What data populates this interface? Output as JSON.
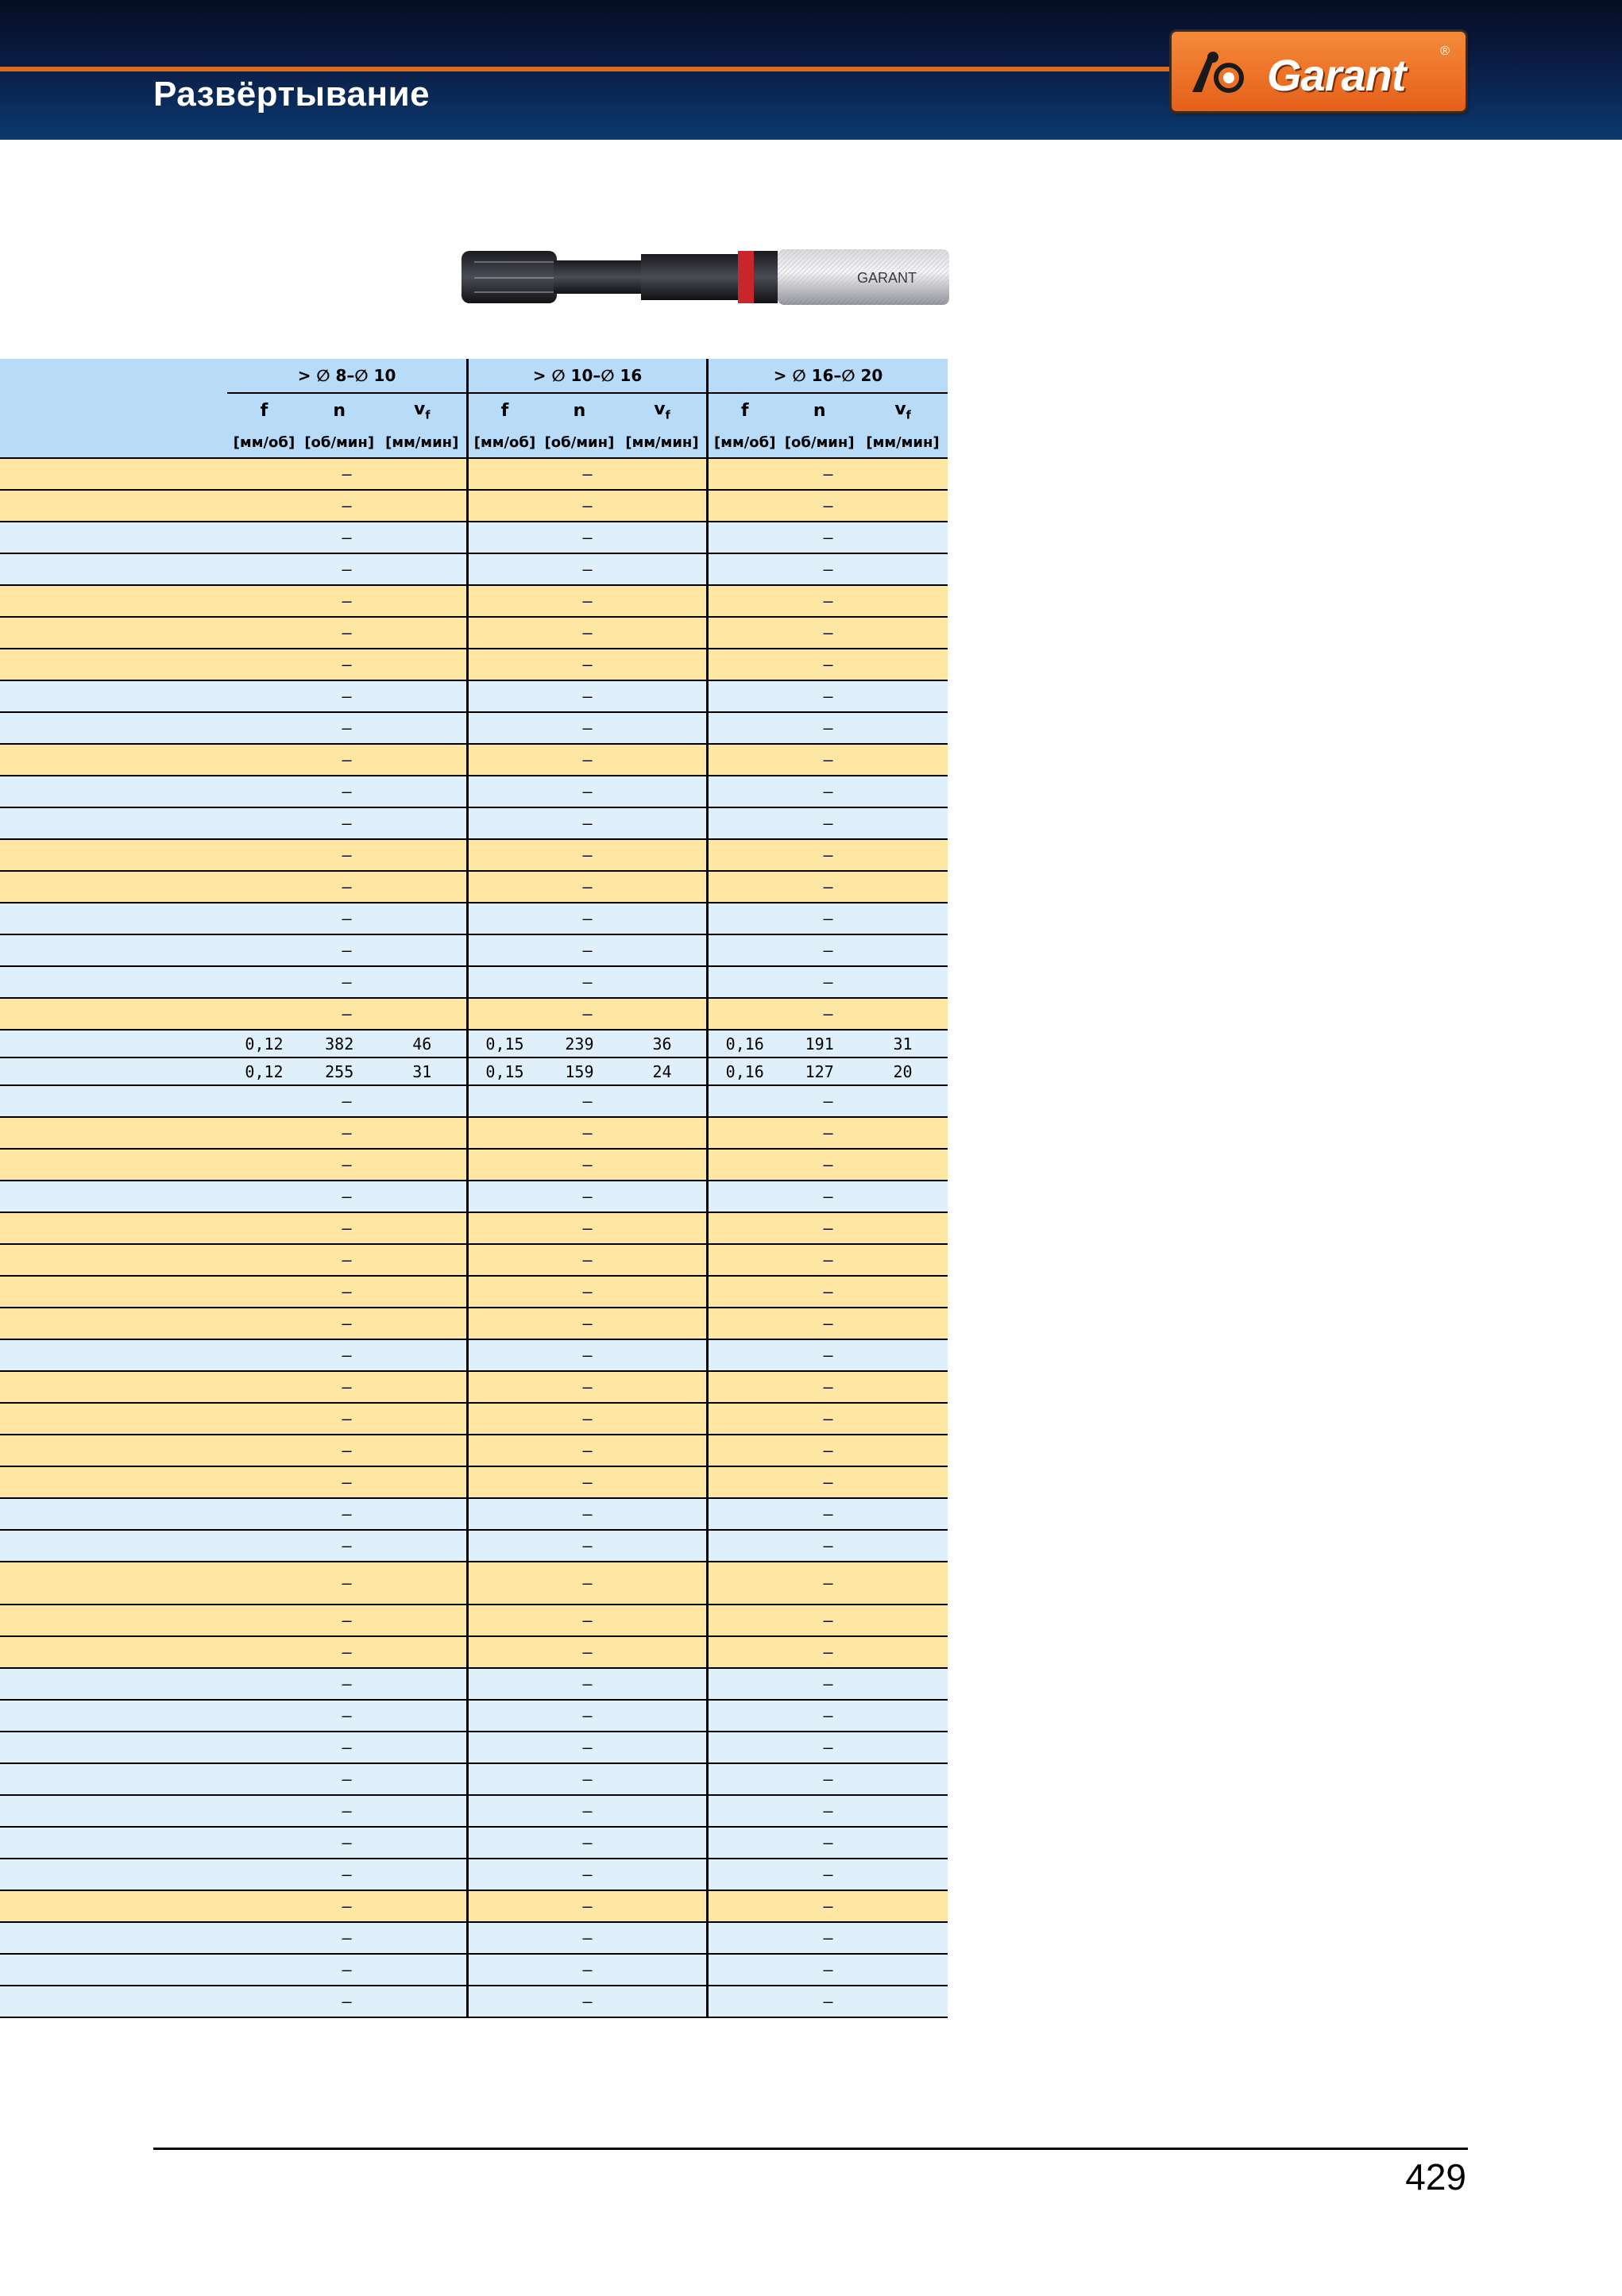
{
  "header": {
    "title": "Развёртывание",
    "logo_text": "Garant",
    "logo_reg": "®"
  },
  "tool": {
    "label": "GARANT"
  },
  "table": {
    "groups": [
      "> ∅ 8–∅ 10",
      "> ∅ 10–∅ 16",
      "> ∅ 16–∅ 20"
    ],
    "params": {
      "f": "f",
      "n": "n",
      "v": "v",
      "v_sub": "f"
    },
    "units": {
      "f": "[мм/об]",
      "n": "[об/мин]",
      "v": "[мм/мин]"
    },
    "rows": [
      {
        "c": "yellow",
        "cells": [
          "–",
          "–",
          "–"
        ]
      },
      {
        "c": "yellow",
        "cells": [
          "–",
          "–",
          "–"
        ]
      },
      {
        "c": "blue",
        "cells": [
          "–",
          "–",
          "–"
        ]
      },
      {
        "c": "blue",
        "cells": [
          "–",
          "–",
          "–"
        ]
      },
      {
        "c": "yellow",
        "cells": [
          "–",
          "–",
          "–"
        ]
      },
      {
        "c": "yellow",
        "cells": [
          "–",
          "–",
          "–"
        ]
      },
      {
        "c": "yellow",
        "cells": [
          "–",
          "–",
          "–"
        ]
      },
      {
        "c": "blue",
        "cells": [
          "–",
          "–",
          "–"
        ]
      },
      {
        "c": "blue",
        "cells": [
          "–",
          "–",
          "–"
        ]
      },
      {
        "c": "yellow",
        "cells": [
          "–",
          "–",
          "–"
        ]
      },
      {
        "c": "blue",
        "cells": [
          "–",
          "–",
          "–"
        ]
      },
      {
        "c": "blue",
        "cells": [
          "–",
          "–",
          "–"
        ]
      },
      {
        "c": "yellow",
        "cells": [
          "–",
          "–",
          "–"
        ]
      },
      {
        "c": "yellow",
        "cells": [
          "–",
          "–",
          "–"
        ]
      },
      {
        "c": "blue",
        "cells": [
          "–",
          "–",
          "–"
        ]
      },
      {
        "c": "blue",
        "cells": [
          "–",
          "–",
          "–"
        ]
      },
      {
        "c": "blue",
        "cells": [
          "–",
          "–",
          "–"
        ]
      },
      {
        "c": "yellow",
        "cells": [
          "–",
          "–",
          "–"
        ]
      },
      {
        "c": "blue",
        "num": true,
        "values": [
          "0,12",
          "382",
          "46",
          "0,15",
          "239",
          "36",
          "0,16",
          "191",
          "31"
        ]
      },
      {
        "c": "blue",
        "num": true,
        "values": [
          "0,12",
          "255",
          "31",
          "0,15",
          "159",
          "24",
          "0,16",
          "127",
          "20"
        ]
      },
      {
        "c": "blue",
        "cells": [
          "–",
          "–",
          "–"
        ]
      },
      {
        "c": "yellow",
        "cells": [
          "–",
          "–",
          "–"
        ]
      },
      {
        "c": "yellow",
        "cells": [
          "–",
          "–",
          "–"
        ]
      },
      {
        "c": "blue",
        "cells": [
          "–",
          "–",
          "–"
        ]
      },
      {
        "c": "yellow",
        "cells": [
          "–",
          "–",
          "–"
        ]
      },
      {
        "c": "yellow",
        "cells": [
          "–",
          "–",
          "–"
        ]
      },
      {
        "c": "yellow",
        "cells": [
          "–",
          "–",
          "–"
        ]
      },
      {
        "c": "yellow",
        "cells": [
          "–",
          "–",
          "–"
        ]
      },
      {
        "c": "blue",
        "cells": [
          "–",
          "–",
          "–"
        ]
      },
      {
        "c": "yellow",
        "cells": [
          "–",
          "–",
          "–"
        ]
      },
      {
        "c": "yellow",
        "cells": [
          "–",
          "–",
          "–"
        ]
      },
      {
        "c": "yellow",
        "cells": [
          "–",
          "–",
          "–"
        ]
      },
      {
        "c": "yellow",
        "cells": [
          "–",
          "–",
          "–"
        ]
      },
      {
        "c": "blue",
        "cells": [
          "–",
          "–",
          "–"
        ]
      },
      {
        "c": "blue",
        "cells": [
          "–",
          "–",
          "–"
        ]
      },
      {
        "c": "yellow",
        "tall": true,
        "cells": [
          "–",
          "–",
          "–"
        ]
      },
      {
        "c": "yellow",
        "cells": [
          "–",
          "–",
          "–"
        ]
      },
      {
        "c": "yellow",
        "cells": [
          "–",
          "–",
          "–"
        ]
      },
      {
        "c": "blue",
        "cells": [
          "–",
          "–",
          "–"
        ]
      },
      {
        "c": "blue",
        "cells": [
          "–",
          "–",
          "–"
        ]
      },
      {
        "c": "blue",
        "cells": [
          "–",
          "–",
          "–"
        ]
      },
      {
        "c": "blue",
        "cells": [
          "–",
          "–",
          "–"
        ]
      },
      {
        "c": "blue",
        "cells": [
          "–",
          "–",
          "–"
        ]
      },
      {
        "c": "blue",
        "cells": [
          "–",
          "–",
          "–"
        ]
      },
      {
        "c": "blue",
        "cells": [
          "–",
          "–",
          "–"
        ]
      },
      {
        "c": "yellow",
        "cells": [
          "–",
          "–",
          "–"
        ]
      },
      {
        "c": "blue",
        "cells": [
          "–",
          "–",
          "–"
        ]
      },
      {
        "c": "blue",
        "cells": [
          "–",
          "–",
          "–"
        ]
      },
      {
        "c": "blue",
        "cells": [
          "–",
          "–",
          "–"
        ]
      }
    ]
  },
  "footer": {
    "page_number": "429"
  },
  "colors": {
    "header_bg": "#0b1c44",
    "accent_orange": "#e06a1a",
    "row_yellow": "#fde7a3",
    "row_blue": "#dff0fb",
    "header_row": "#b8dbf7"
  }
}
